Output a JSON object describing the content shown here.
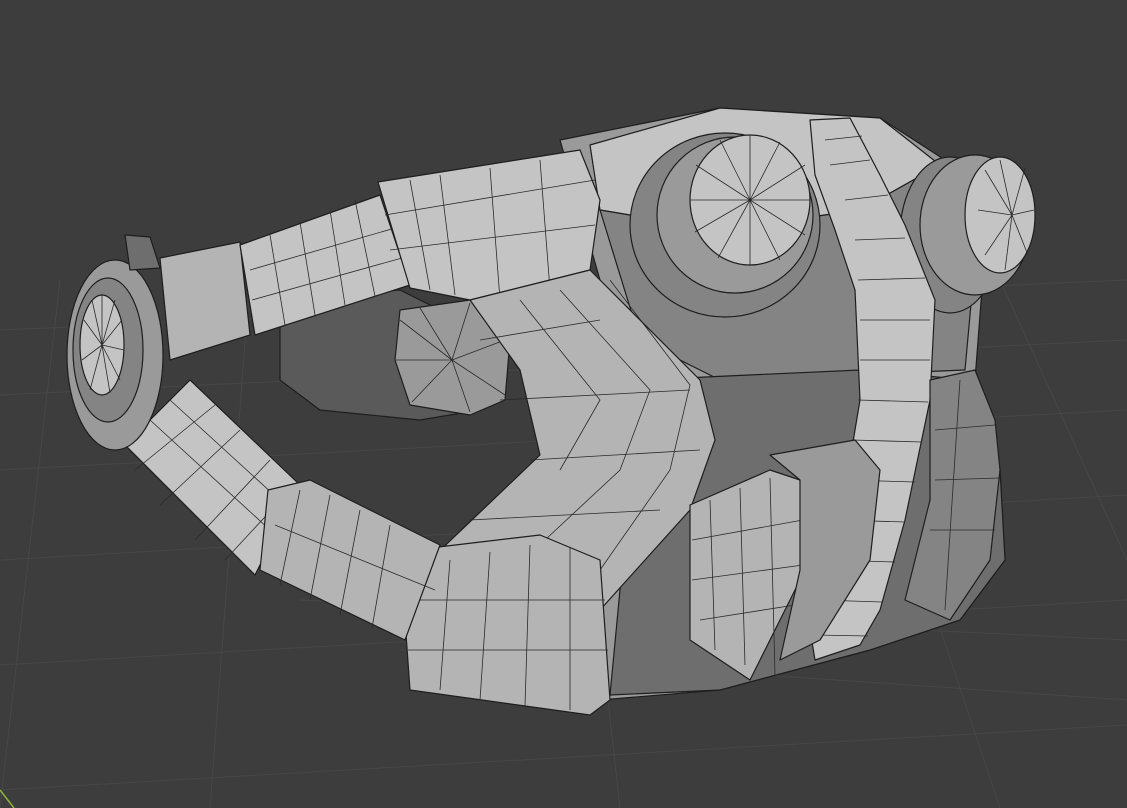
{
  "viewport": {
    "background": "#3d3d3d",
    "grid_color": "#474747",
    "mesh_shade_light": "#c4c4c4",
    "mesh_shade_mid": "#9a9a9a",
    "mesh_shade_dark": "#6e6e6e",
    "wire_color": "#1e1e1e",
    "x_axis_color": "#8fb23a"
  },
  "mesh": {
    "display": "solid-with-wireframe"
  }
}
